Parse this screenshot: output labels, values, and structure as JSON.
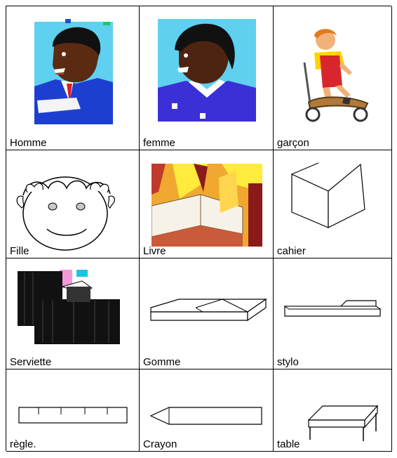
{
  "cards": [
    {
      "word": "Homme",
      "picture": "man-portrait"
    },
    {
      "word": "femme",
      "picture": "woman-portrait"
    },
    {
      "word": "garçon",
      "picture": "boy-on-scooter"
    },
    {
      "word": "Fille",
      "picture": "girl-face"
    },
    {
      "word": "Livre",
      "picture": "open-book"
    },
    {
      "word": "cahier",
      "picture": "notebook"
    },
    {
      "word": "Serviette",
      "picture": "briefcase"
    },
    {
      "word": "Gomme",
      "picture": "eraser"
    },
    {
      "word": "stylo",
      "picture": "pen"
    },
    {
      "word": "règle.",
      "picture": "ruler"
    },
    {
      "word": "Crayon",
      "picture": "pencil"
    },
    {
      "word": "table",
      "picture": "table"
    }
  ]
}
